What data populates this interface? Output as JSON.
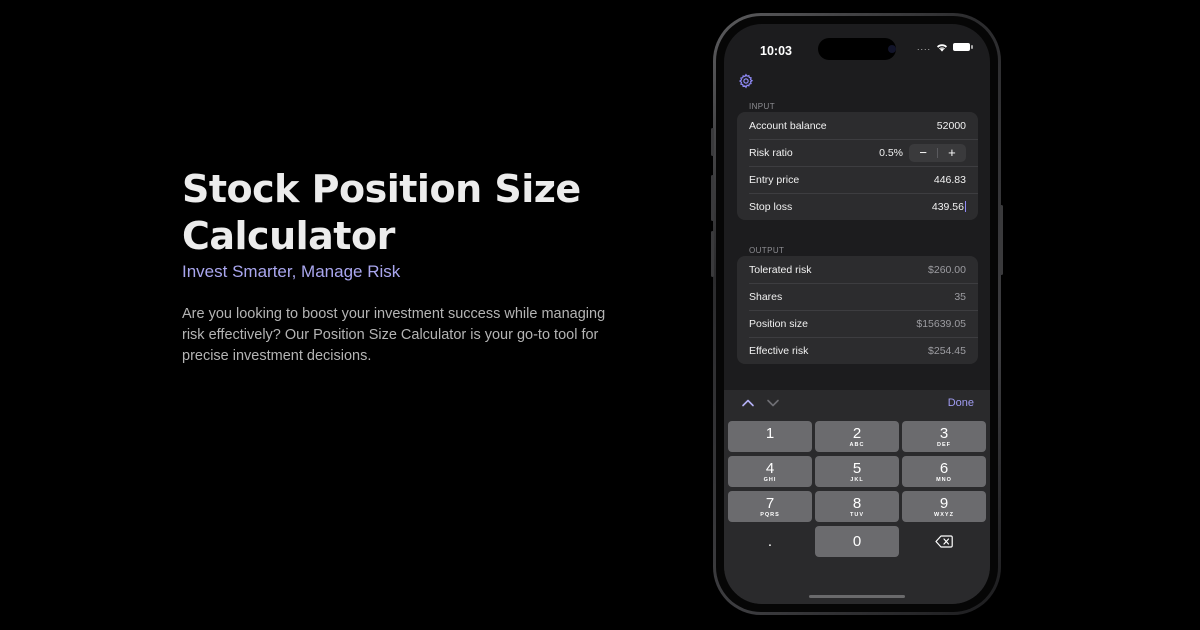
{
  "hero": {
    "title": "Stock Position Size Calculator",
    "subtitle": "Invest Smarter, Manage Risk",
    "description": "Are you looking to boost your investment success while managing risk effectively? Our Position Size Calculator is your go-to tool for precise investment decisions."
  },
  "phone": {
    "status_time": "10:03",
    "status_dots": "....",
    "input_section_label": "INPUT",
    "input": {
      "account_balance": {
        "label": "Account balance",
        "value": "52000"
      },
      "risk_ratio": {
        "label": "Risk ratio",
        "value": "0.5%",
        "minus": "−",
        "plus": "+"
      },
      "entry_price": {
        "label": "Entry price",
        "value": "446.83"
      },
      "stop_loss": {
        "label": "Stop loss",
        "value": "439.56"
      }
    },
    "output_section_label": "OUTPUT",
    "output": {
      "tolerated_risk": {
        "label": "Tolerated risk",
        "value": "$260.00"
      },
      "shares": {
        "label": "Shares",
        "value": "35"
      },
      "position_size": {
        "label": "Position size",
        "value": "$15639.05"
      },
      "effective_risk": {
        "label": "Effective risk",
        "value": "$254.45"
      }
    },
    "keyboard": {
      "done_label": "Done",
      "keys": [
        {
          "num": "1",
          "letters": ""
        },
        {
          "num": "2",
          "letters": "ABC"
        },
        {
          "num": "3",
          "letters": "DEF"
        },
        {
          "num": "4",
          "letters": "GHI"
        },
        {
          "num": "5",
          "letters": "JKL"
        },
        {
          "num": "6",
          "letters": "MNO"
        },
        {
          "num": "7",
          "letters": "PQRS"
        },
        {
          "num": "8",
          "letters": "TUV"
        },
        {
          "num": "9",
          "letters": "WXYZ"
        },
        {
          "num": ".",
          "letters": ""
        },
        {
          "num": "0",
          "letters": ""
        },
        {
          "num": "delete-icon",
          "letters": ""
        }
      ]
    }
  },
  "colors": {
    "background": "#000000",
    "accent": "#a9a6ee",
    "screen_bg": "#1c1c1e",
    "group_bg": "#2c2c2e",
    "key_bg": "#6b6b6e"
  }
}
